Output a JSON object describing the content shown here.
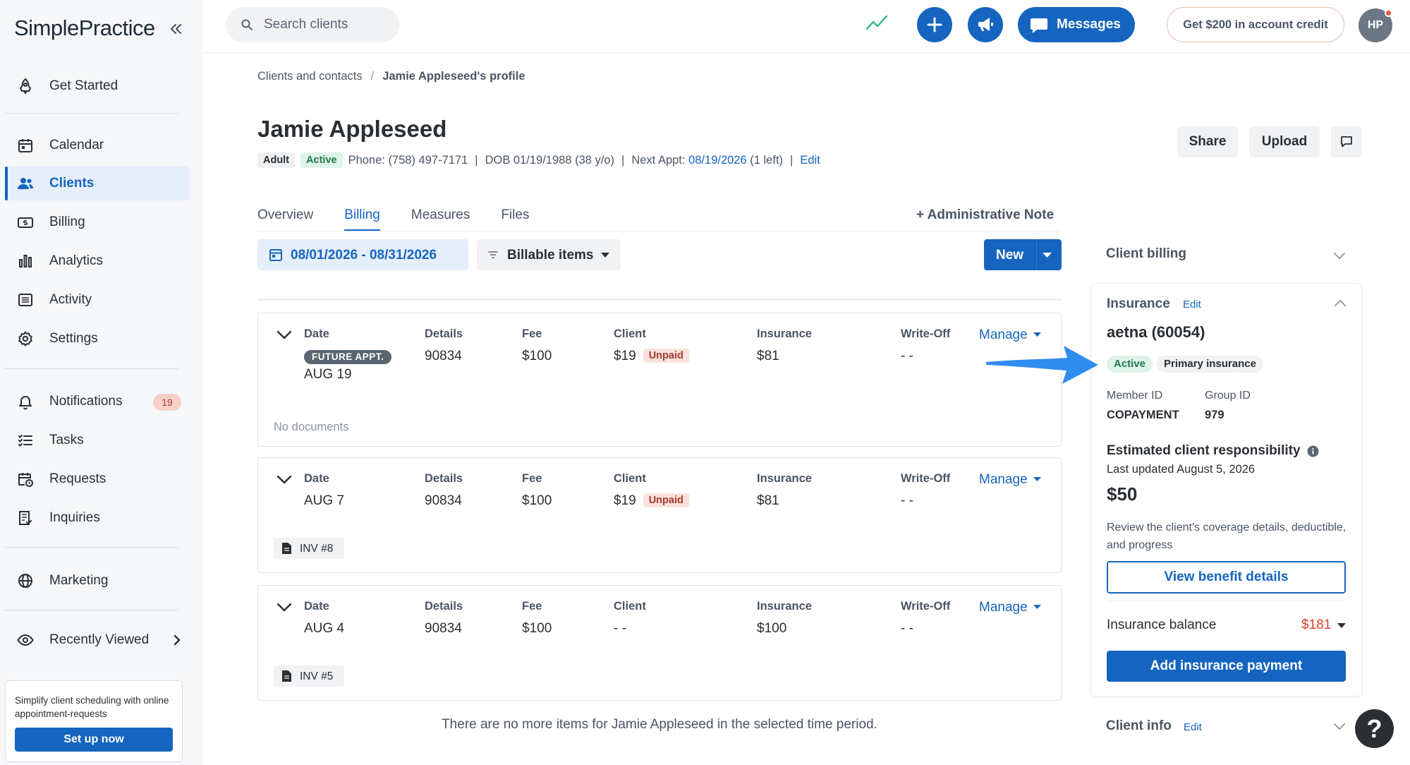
{
  "app": {
    "logo_text": "SimplePractice",
    "search_placeholder": "Search clients",
    "messages_label": "Messages",
    "credit_label": "Get $200 in account credit",
    "avatar_initials": "HP",
    "help_label": "?",
    "brand_color": "#1565c0",
    "icons": {
      "trend": "trend-line-icon",
      "plus": "plus-icon",
      "announce": "megaphone-icon",
      "messages": "chat-bubble-icon"
    }
  },
  "sidebar": {
    "items": [
      {
        "key": "get-started",
        "label": "Get Started",
        "icon": "rocket-icon"
      },
      {
        "key": "calendar",
        "label": "Calendar",
        "icon": "calendar-icon"
      },
      {
        "key": "clients",
        "label": "Clients",
        "icon": "people-icon",
        "active": true
      },
      {
        "key": "billing",
        "label": "Billing",
        "icon": "dollar-bill-icon"
      },
      {
        "key": "analytics",
        "label": "Analytics",
        "icon": "bar-chart-icon"
      },
      {
        "key": "activity",
        "label": "Activity",
        "icon": "list-icon"
      },
      {
        "key": "settings",
        "label": "Settings",
        "icon": "gear-icon"
      },
      {
        "key": "notifications",
        "label": "Notifications",
        "icon": "bell-icon",
        "badge": "19"
      },
      {
        "key": "tasks",
        "label": "Tasks",
        "icon": "checklist-icon"
      },
      {
        "key": "requests",
        "label": "Requests",
        "icon": "calendar-clock-icon"
      },
      {
        "key": "inquiries",
        "label": "Inquiries",
        "icon": "document-list-icon"
      },
      {
        "key": "marketing",
        "label": "Marketing",
        "icon": "globe-icon"
      },
      {
        "key": "recently-viewed",
        "label": "Recently Viewed",
        "icon": "eye-icon"
      }
    ],
    "promo": {
      "text": "Simplify client scheduling with online appointment-requests",
      "button": "Set up now"
    }
  },
  "breadcrumb": {
    "parent": "Clients and contacts",
    "separator": "/",
    "current": "Jamie Appleseed's profile"
  },
  "client": {
    "name": "Jamie Appleseed",
    "tags": [
      "Adult",
      "Active"
    ],
    "phone": "Phone: (758) 497-7171",
    "dob": "DOB 01/19/1988 (38 y/o)",
    "next_appt_label": "Next Appt:",
    "next_appt_date": "08/19/2026",
    "next_appt_left": "(1 left)",
    "edit": "Edit"
  },
  "header_actions": {
    "share": "Share",
    "upload": "Upload"
  },
  "tabs": [
    {
      "label": "Overview"
    },
    {
      "label": "Billing",
      "active": true
    },
    {
      "label": "Measures"
    },
    {
      "label": "Files"
    }
  ],
  "admin_note": "+ Administrative Note",
  "toolbar": {
    "date_range": "08/01/2026 - 08/31/2026",
    "filter": "Billable items",
    "new": "New"
  },
  "columns": {
    "date": "Date",
    "details": "Details",
    "fee": "Fee",
    "client": "Client",
    "insurance": "Insurance",
    "writeoff": "Write-Off",
    "manage": "Manage"
  },
  "billing_items": [
    {
      "future_tag": "FUTURE APPT.",
      "date": "AUG 19",
      "details": "90834",
      "fee": "$100",
      "client": "$19",
      "client_status": "Unpaid",
      "insurance": "$81",
      "writeoff": "- -",
      "footer": "No documents"
    },
    {
      "date": "AUG 7",
      "details": "90834",
      "fee": "$100",
      "client": "$19",
      "client_status": "Unpaid",
      "insurance": "$81",
      "writeoff": "- -",
      "invoice": "INV #8"
    },
    {
      "date": "AUG 4",
      "details": "90834",
      "fee": "$100",
      "client": "- -",
      "insurance": "$100",
      "writeoff": "- -",
      "invoice": "INV #5"
    }
  ],
  "no_more_items": "There are no more items for Jamie Appleseed in the selected time period.",
  "right_panel": {
    "client_billing": "Client billing",
    "insurance": {
      "title": "Insurance",
      "edit": "Edit",
      "payer": "aetna (60054)",
      "status": "Active",
      "type": "Primary insurance",
      "member_id_label": "Member ID",
      "member_id": "COPAYMENT",
      "group_id_label": "Group ID",
      "group_id": "979",
      "est_title": "Estimated client responsibility",
      "est_updated": "Last updated August 5, 2026",
      "est_amount": "$50",
      "est_desc": "Review the client's coverage details, deductible, and progress",
      "view_benefits": "View benefit details",
      "balance_label": "Insurance balance",
      "balance_value": "$181",
      "add_payment": "Add insurance payment"
    },
    "client_info": "Client info",
    "client_info_edit": "Edit"
  }
}
